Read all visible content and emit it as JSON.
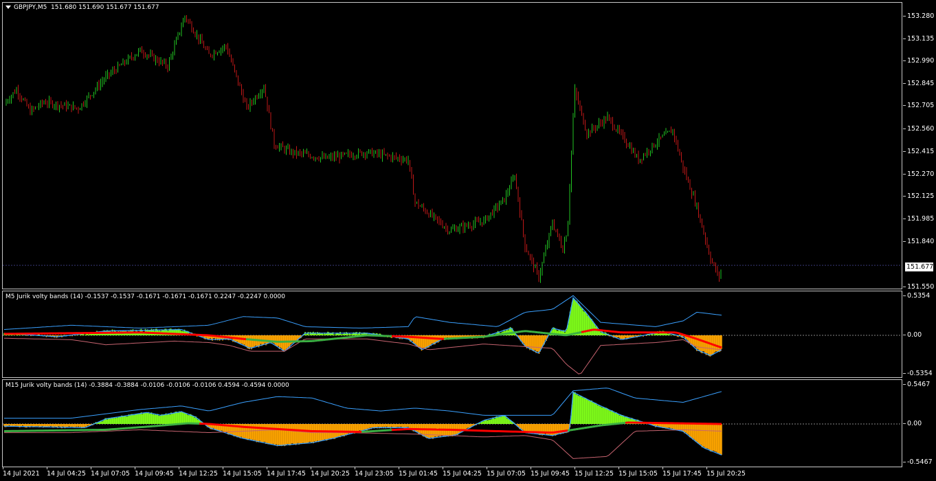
{
  "main": {
    "symbol": "GBPJPY,M5",
    "ohlc": "151.680 151.690 151.677 151.677",
    "current_price": "151.677",
    "price_ticks": [
      "153.280",
      "153.135",
      "152.990",
      "152.845",
      "152.705",
      "152.560",
      "152.415",
      "152.270",
      "152.125",
      "151.985",
      "151.840",
      "151.550"
    ]
  },
  "indicator1": {
    "label": "M5 Jurik volty bands (14) -0.1537 -0.1537 -0.1671 -0.1671 -0.1671 0.2247 -0.2247 0.0000",
    "ticks": [
      "0.5354",
      "0.00",
      "-0.5354"
    ]
  },
  "indicator2": {
    "label": "M15 Jurik volty bands (14) -0.3884 -0.3884 -0.0106 -0.0106 -0.0106 0.4594 -0.4594 0.0000",
    "ticks": [
      "0.5467",
      "0.00",
      "-0.5467"
    ]
  },
  "time_axis": [
    "14 Jul 2021",
    "14 Jul 04:25",
    "14 Jul 07:05",
    "14 Jul 09:45",
    "14 Jul 12:25",
    "14 Jul 15:05",
    "14 Jul 17:45",
    "14 Jul 20:25",
    "14 Jul 23:05",
    "15 Jul 01:45",
    "15 Jul 04:25",
    "15 Jul 07:05",
    "15 Jul 09:45",
    "15 Jul 12:25",
    "15 Jul 15:05",
    "15 Jul 17:45",
    "15 Jul 20:25"
  ],
  "chart_data": [
    {
      "type": "candlestick",
      "title": "GBPJPY,M5",
      "ylim": [
        151.55,
        153.28
      ],
      "x": [
        "14 Jul 2021",
        "14 Jul 04:25",
        "14 Jul 07:05",
        "14 Jul 09:45",
        "14 Jul 12:25",
        "14 Jul 15:05",
        "14 Jul 17:45",
        "14 Jul 20:25",
        "14 Jul 23:05",
        "15 Jul 01:45",
        "15 Jul 04:25",
        "15 Jul 07:05",
        "15 Jul 09:45",
        "15 Jul 12:25",
        "15 Jul 15:05",
        "15 Jul 17:45",
        "15 Jul 20:25"
      ],
      "close": [
        152.72,
        152.7,
        152.74,
        153.02,
        153.15,
        152.98,
        152.41,
        152.38,
        152.4,
        152.08,
        151.96,
        152.18,
        151.88,
        152.58,
        152.4,
        152.55,
        151.677
      ]
    },
    {
      "type": "area",
      "title": "M5 Jurik volty bands (14)",
      "ylim": [
        -0.5354,
        0.5354
      ],
      "x": [
        "14 Jul 2021",
        "14 Jul 04:25",
        "14 Jul 07:05",
        "14 Jul 09:45",
        "14 Jul 12:25",
        "14 Jul 15:05",
        "14 Jul 17:45",
        "14 Jul 20:25",
        "14 Jul 23:05",
        "15 Jul 01:45",
        "15 Jul 04:25",
        "15 Jul 07:05",
        "15 Jul 09:45",
        "15 Jul 12:25",
        "15 Jul 15:05",
        "15 Jul 17:45",
        "15 Jul 20:25"
      ],
      "series": [
        {
          "values": [
            0.05,
            0.0,
            0.05,
            0.05,
            0.05,
            -0.1,
            -0.12,
            0.03,
            0.02,
            -0.12,
            -0.08,
            -0.12,
            0.08,
            0.45,
            0.05,
            0.03,
            -0.22
          ]
        }
      ]
    },
    {
      "type": "area",
      "title": "M15 Jurik volty bands (14)",
      "ylim": [
        -0.5467,
        0.5467
      ],
      "x": [
        "14 Jul 2021",
        "14 Jul 04:25",
        "14 Jul 07:05",
        "14 Jul 09:45",
        "14 Jul 12:25",
        "14 Jul 15:05",
        "14 Jul 17:45",
        "14 Jul 20:25",
        "14 Jul 23:05",
        "15 Jul 01:45",
        "15 Jul 04:25",
        "15 Jul 07:05",
        "15 Jul 09:45",
        "15 Jul 12:25",
        "15 Jul 15:05",
        "15 Jul 17:45",
        "15 Jul 20:25"
      ],
      "series": [
        {
          "values": [
            -0.03,
            -0.05,
            0.05,
            0.18,
            0.15,
            -0.1,
            -0.3,
            -0.28,
            -0.05,
            -0.1,
            -0.2,
            0.1,
            -0.1,
            0.45,
            0.02,
            -0.1,
            -0.43
          ]
        }
      ]
    }
  ],
  "colors": {
    "bull": "#22c422",
    "bear": "#c01818",
    "fill_up": "#80ff1a",
    "fill_down": "#ffa500",
    "band": "#3aa0ff",
    "red_line": "#ff0000",
    "green_line": "#3cb043",
    "lower_band": "#c86470"
  }
}
